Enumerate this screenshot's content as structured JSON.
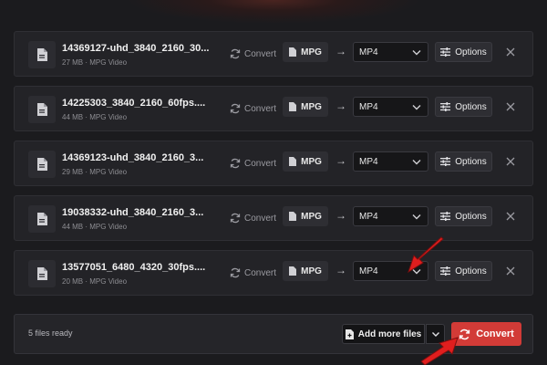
{
  "files": [
    {
      "name": "14369127-uhd_3840_2160_30...",
      "size": "27 MB",
      "type": "MPG Video",
      "convert_label": "Convert",
      "source_format": "MPG",
      "target_format": "MP4",
      "options_label": "Options"
    },
    {
      "name": "14225303_3840_2160_60fps....",
      "size": "44 MB",
      "type": "MPG Video",
      "convert_label": "Convert",
      "source_format": "MPG",
      "target_format": "MP4",
      "options_label": "Options"
    },
    {
      "name": "14369123-uhd_3840_2160_3...",
      "size": "29 MB",
      "type": "MPG Video",
      "convert_label": "Convert",
      "source_format": "MPG",
      "target_format": "MP4",
      "options_label": "Options"
    },
    {
      "name": "19038332-uhd_3840_2160_3...",
      "size": "44 MB",
      "type": "MPG Video",
      "convert_label": "Convert",
      "source_format": "MPG",
      "target_format": "MP4",
      "options_label": "Options"
    },
    {
      "name": "13577051_6480_4320_30fps....",
      "size": "20 MB",
      "type": "MPG Video",
      "convert_label": "Convert",
      "source_format": "MPG",
      "target_format": "MP4",
      "options_label": "Options"
    }
  ],
  "meta_separator": "·",
  "footer": {
    "status": "5 files ready",
    "add_more_label": "Add more files",
    "convert_label": "Convert"
  },
  "colors": {
    "accent": "#d23b37",
    "annotation_arrow": "#e01e1e",
    "background": "#1b1b1e",
    "row_background": "#232327"
  },
  "icons": {
    "file": "file-icon",
    "convert": "refresh-icon",
    "arrow": "arrow-right-icon",
    "options": "sliders-icon",
    "remove": "close-icon",
    "dropdown": "chevron-down-icon",
    "add_file": "file-plus-icon"
  }
}
